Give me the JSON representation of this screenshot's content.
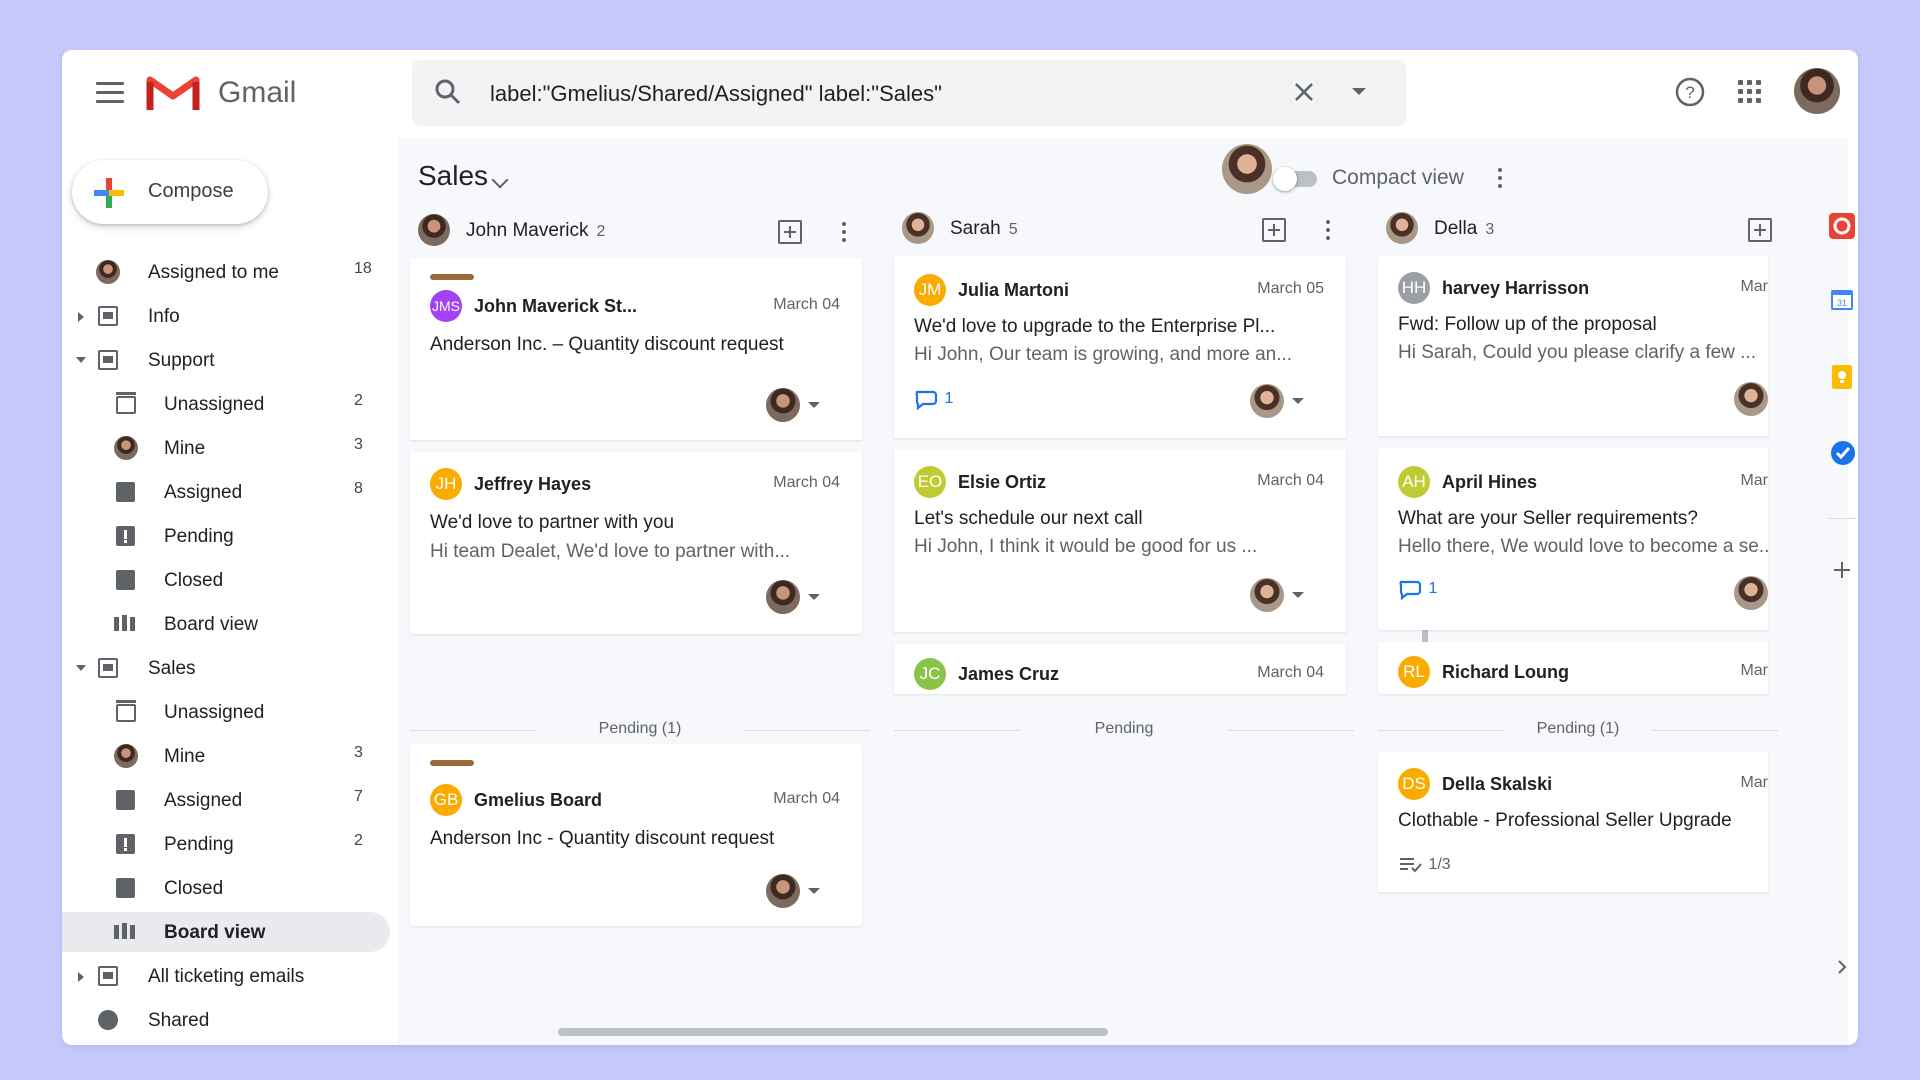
{
  "app": {
    "name": "Gmail"
  },
  "search": {
    "query": "label:\"Gmelius/Shared/Assigned\" label:\"Sales\""
  },
  "compose": {
    "label": "Compose"
  },
  "nav": [
    {
      "label": "Assigned to me",
      "count": "18"
    },
    {
      "label": "Info",
      "count": ""
    },
    {
      "label": "Support",
      "count": ""
    },
    {
      "label": "Unassigned",
      "count": "2"
    },
    {
      "label": "Mine",
      "count": "3"
    },
    {
      "label": "Assigned",
      "count": "8"
    },
    {
      "label": "Pending",
      "count": ""
    },
    {
      "label": "Closed",
      "count": ""
    },
    {
      "label": "Board view",
      "count": ""
    },
    {
      "label": "Sales",
      "count": ""
    },
    {
      "label": "Unassigned",
      "count": ""
    },
    {
      "label": "Mine",
      "count": "3"
    },
    {
      "label": "Assigned",
      "count": "7"
    },
    {
      "label": "Pending",
      "count": "2"
    },
    {
      "label": "Closed",
      "count": ""
    },
    {
      "label": "Board view",
      "count": ""
    },
    {
      "label": "All ticketing emails",
      "count": ""
    },
    {
      "label": "Shared",
      "count": ""
    }
  ],
  "board": {
    "title": "Sales",
    "compact_view_label": "Compact view",
    "columns": [
      {
        "name": "John Maverick",
        "count": "2",
        "pending_label": "Pending (1)"
      },
      {
        "name": "Sarah",
        "count": "5",
        "pending_label": "Pending"
      },
      {
        "name": "Della",
        "count": "3",
        "pending_label": "Pending (1)"
      }
    ],
    "cards": {
      "c1": {
        "initials": "JMS",
        "sender": "John Maverick St...",
        "date": "March 04",
        "subject": "Anderson Inc. – Quantity discount request"
      },
      "c2": {
        "initials": "JH",
        "sender": "Jeffrey Hayes",
        "date": "March 04",
        "subject": "We'd love to partner with you",
        "snippet": "Hi team Dealet, We'd love to partner with..."
      },
      "c3": {
        "initials": "GB",
        "sender": "Gmelius Board",
        "date": "March 04",
        "subject": "Anderson Inc - Quantity discount request"
      },
      "s1": {
        "initials": "JM",
        "sender": "Julia Martoni",
        "date": "March 05",
        "subject": "We'd love to upgrade to the Enterprise Pl...",
        "snippet": "Hi John, Our team is growing, and more an...",
        "comments": "1"
      },
      "s2": {
        "initials": "EO",
        "sender": "Elsie Ortiz",
        "date": "March 04",
        "subject": "Let's schedule our next call",
        "snippet": "Hi John, I think it would be good for us ..."
      },
      "s3": {
        "initials": "JC",
        "sender": "James Cruz",
        "date": "March 04"
      },
      "d1": {
        "initials": "HH",
        "sender": "harvey Harrisson",
        "date": "Mar",
        "subject": "Fwd: Follow up of the proposal",
        "snippet": "Hi Sarah, Could you please clarify a few ..."
      },
      "d2": {
        "initials": "AH",
        "sender": "April Hines",
        "date": "Mar",
        "subject": "What are your Seller requirements?",
        "snippet": "Hello there, We would love to become a se...",
        "comments": "1"
      },
      "d3": {
        "initials": "RL",
        "sender": "Richard Loung",
        "date": "Mar"
      },
      "d4": {
        "initials": "DS",
        "sender": "Della Skalski",
        "date": "Mar",
        "subject": "Clothable - Professional Seller Upgrade",
        "tasks": "1/3"
      }
    }
  },
  "colors": {
    "background": "#c4c8fb",
    "label_bar": "#9b6937",
    "accent": "#1a73e8"
  }
}
